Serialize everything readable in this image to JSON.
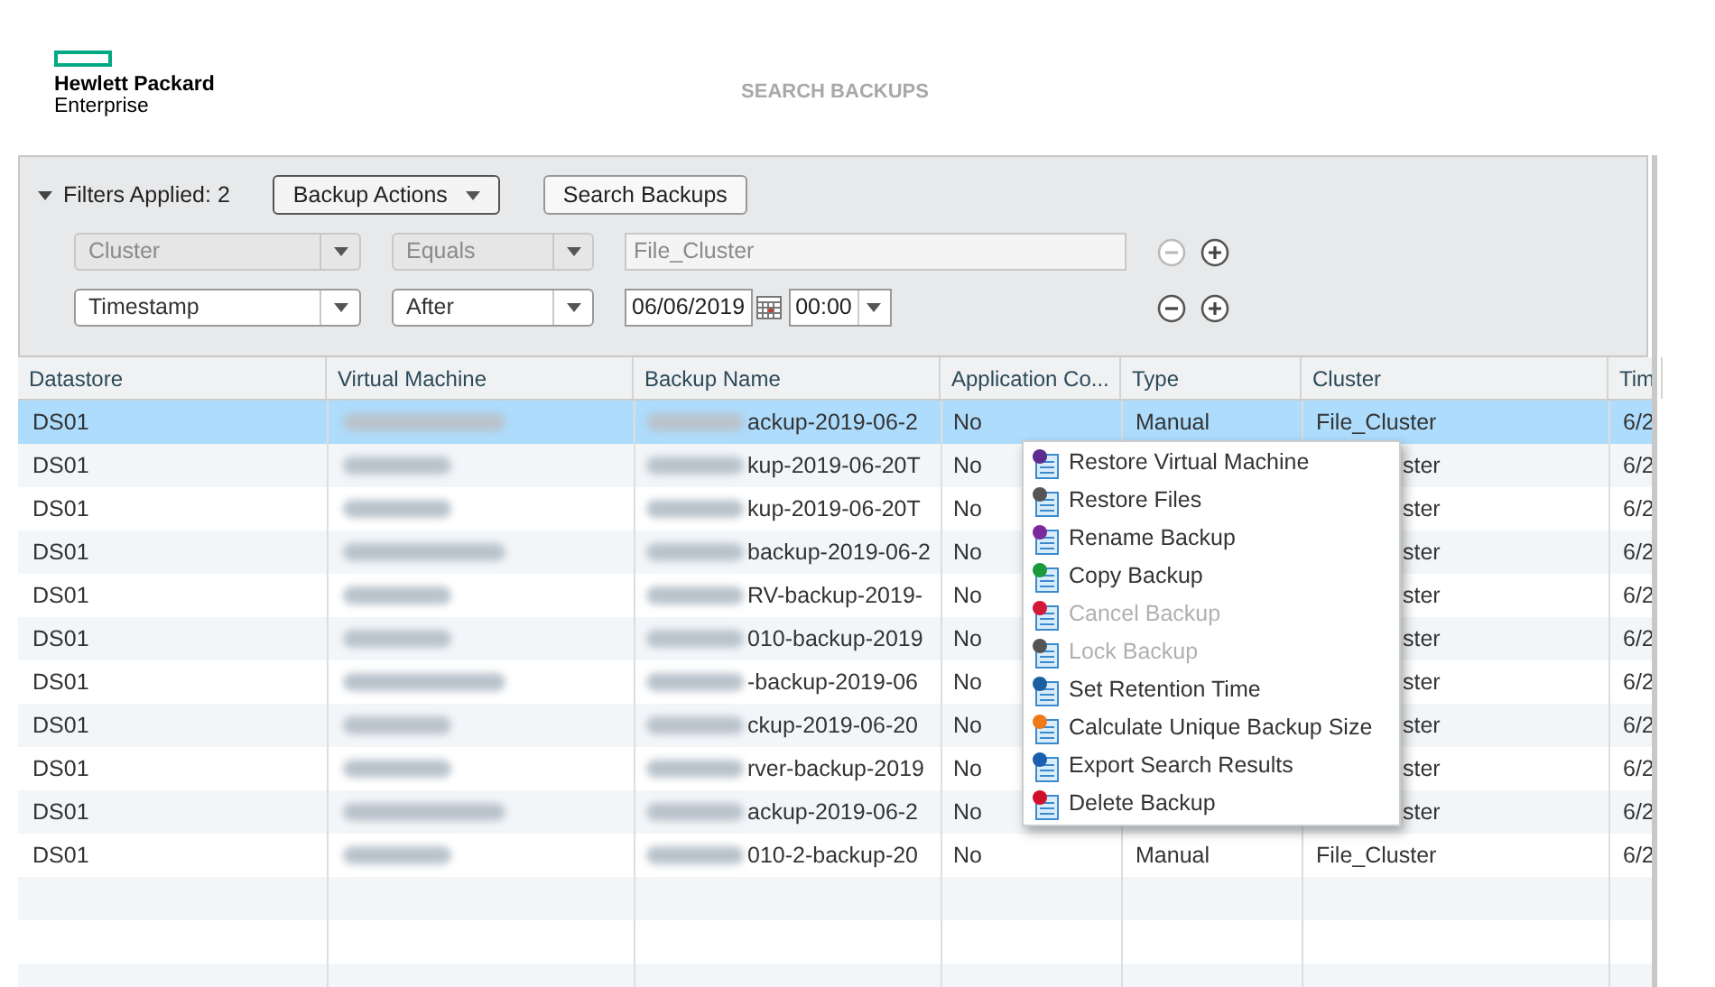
{
  "brand": {
    "line_1": "Hewlett Packard",
    "line_2": "Enterprise"
  },
  "page_title": "SEARCH BACKUPS",
  "filters": {
    "summary": "Filters Applied: 2",
    "expanded": true,
    "actions_button": "Backup Actions",
    "search_button": "Search Backups",
    "rows": [
      {
        "field": "Cluster",
        "operator": "Equals",
        "value": "File_Cluster",
        "kind": "text",
        "disabled": true
      },
      {
        "field": "Timestamp",
        "operator": "After",
        "date": "06/06/2019",
        "time": "00:00",
        "kind": "datetime",
        "disabled": false
      }
    ]
  },
  "table": {
    "columns": [
      "Datastore",
      "Virtual Machine",
      "Backup Name",
      "Application Co...",
      "Type",
      "Cluster",
      "Tim"
    ],
    "rows": [
      {
        "datastore": "DS01",
        "backup_name": "ackup-2019-06-2",
        "application": "No",
        "type": "Manual",
        "cluster": "File_Cluster",
        "timestamp": "6/2",
        "selected": true
      },
      {
        "datastore": "DS01",
        "backup_name": "kup-2019-06-20T",
        "application": "No",
        "cluster": "ster",
        "timestamp": "6/2",
        "selected": false
      },
      {
        "datastore": "DS01",
        "backup_name": "kup-2019-06-20T",
        "application": "No",
        "cluster": "ster",
        "timestamp": "6/2",
        "selected": false
      },
      {
        "datastore": "DS01",
        "backup_name": "backup-2019-06-2",
        "application": "No",
        "cluster": "ster",
        "timestamp": "6/2",
        "selected": false
      },
      {
        "datastore": "DS01",
        "backup_name": "RV-backup-2019-",
        "application": "No",
        "cluster": "ster",
        "timestamp": "6/2",
        "selected": false
      },
      {
        "datastore": "DS01",
        "backup_name": "010-backup-2019",
        "application": "No",
        "cluster": "ster",
        "timestamp": "6/2",
        "selected": false
      },
      {
        "datastore": "DS01",
        "backup_name": "-backup-2019-06",
        "application": "No",
        "cluster": "ster",
        "timestamp": "6/2",
        "selected": false
      },
      {
        "datastore": "DS01",
        "backup_name": "ckup-2019-06-20",
        "application": "No",
        "cluster": "ster",
        "timestamp": "6/2",
        "selected": false
      },
      {
        "datastore": "DS01",
        "backup_name": "rver-backup-2019",
        "application": "No",
        "cluster": "ster",
        "timestamp": "6/2",
        "selected": false
      },
      {
        "datastore": "DS01",
        "backup_name": "ackup-2019-06-2",
        "application": "No",
        "cluster": "ster",
        "timestamp": "6/2",
        "selected": false
      },
      {
        "datastore": "DS01",
        "backup_name": "010-2-backup-20",
        "application": "No",
        "type": "Manual",
        "cluster": "File_Cluster",
        "timestamp": "6/2",
        "selected": false
      }
    ]
  },
  "context_menu": {
    "items": [
      {
        "label": "Restore Virtual Machine",
        "color": "#5b2d90",
        "disabled": false
      },
      {
        "label": "Restore Files",
        "color": "#555555",
        "disabled": false
      },
      {
        "label": "Rename Backup",
        "color": "#7a2a9a",
        "disabled": false
      },
      {
        "label": "Copy Backup",
        "color": "#1a9a3a",
        "disabled": false
      },
      {
        "label": "Cancel Backup",
        "color": "#d4183a",
        "disabled": true
      },
      {
        "label": "Lock Backup",
        "color": "#555555",
        "disabled": true
      },
      {
        "label": "Set Retention Time",
        "color": "#1a5fa0",
        "disabled": false
      },
      {
        "label": "Calculate Unique Backup Size",
        "color": "#f07a1a",
        "disabled": false
      },
      {
        "label": "Export Search Results",
        "color": "#1a5fb0",
        "disabled": false
      },
      {
        "label": "Delete Backup",
        "color": "#d0102a",
        "disabled": false
      }
    ]
  }
}
